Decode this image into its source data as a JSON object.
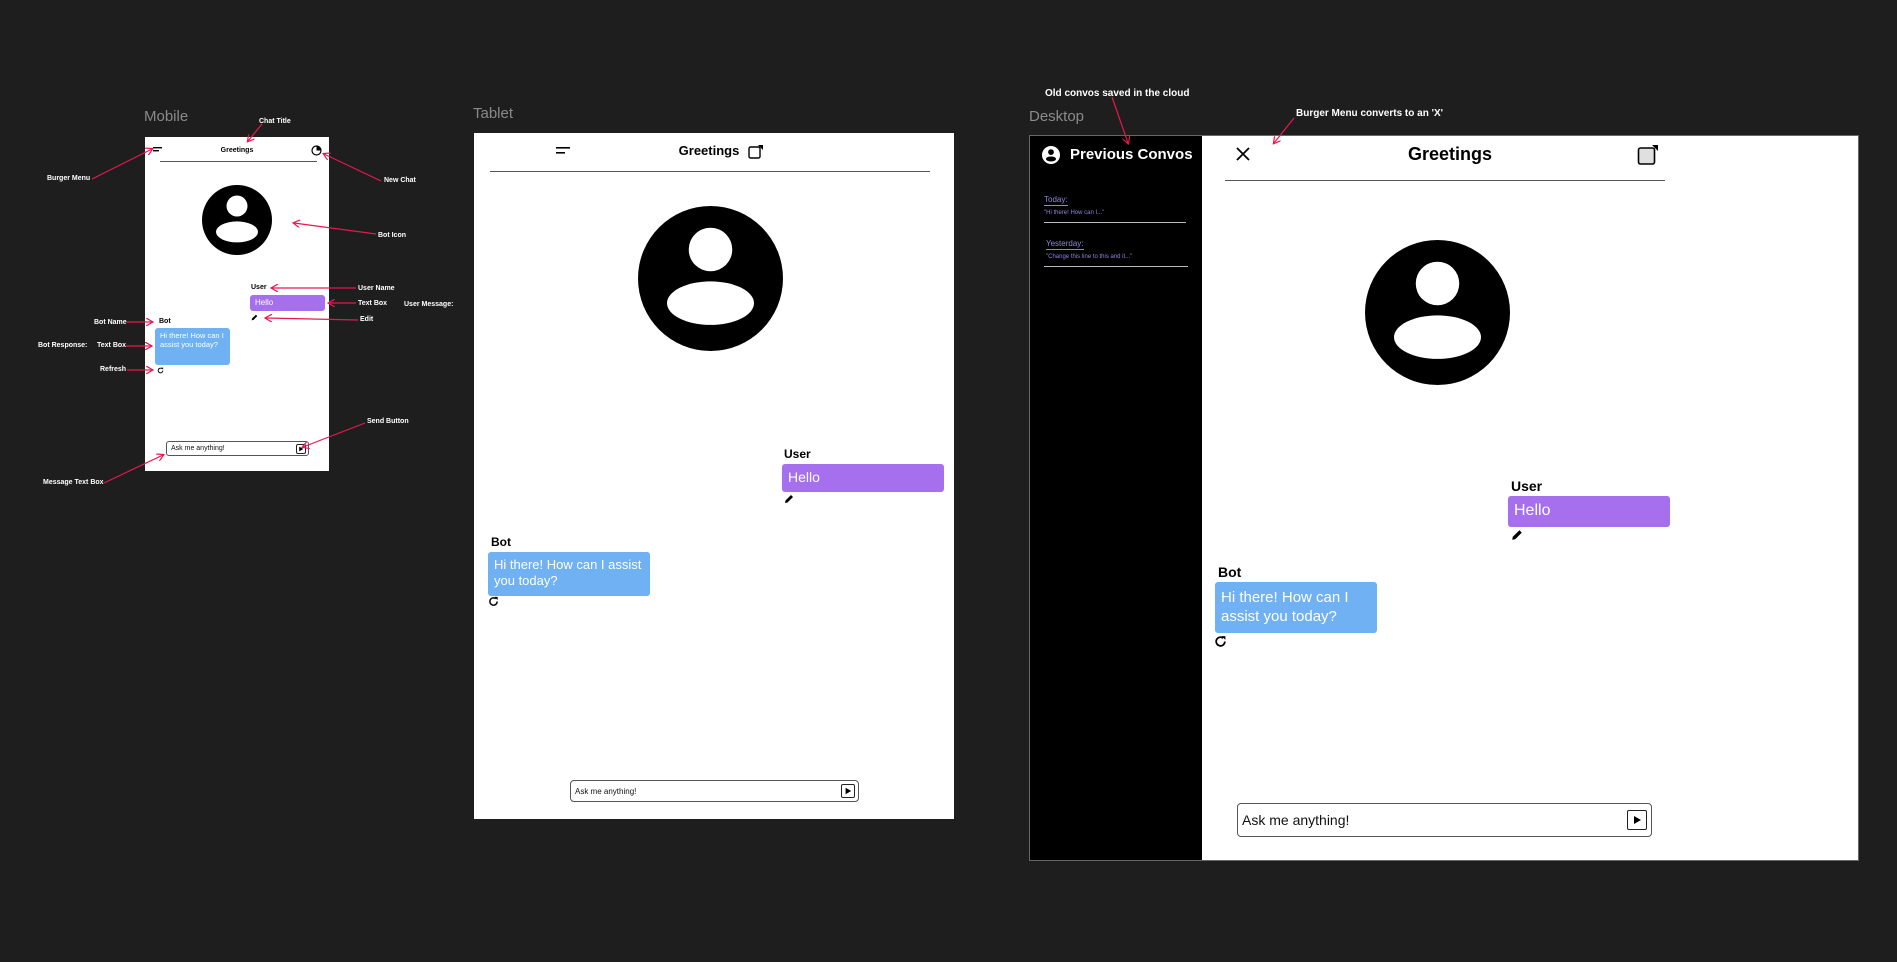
{
  "colors": {
    "canvas": "#1e1e1e",
    "screen": "#ffffff",
    "user_bubble": "#a66fee",
    "bot_bubble": "#6fb1f2",
    "annotation_arrow": "#e8174f",
    "sidebar": "#000000",
    "sidebar_text": "#8e86d8"
  },
  "frames": {
    "mobile_label": "Mobile",
    "tablet_label": "Tablet",
    "desktop_label": "Desktop"
  },
  "chat": {
    "title": "Greetings",
    "user_name": "User",
    "user_message": "Hello",
    "bot_name": "Bot",
    "bot_message": "Hi there! How can I assist you today?",
    "input_placeholder": "Ask me anything!"
  },
  "sidebar": {
    "heading": "Previous Convos",
    "convos": [
      {
        "day": "Today:",
        "preview": "\"Hi there! How can I...\""
      },
      {
        "day": "Yesterday:",
        "preview": "\"Change this line to this and it...\""
      }
    ]
  },
  "annotations": {
    "chat_title": "Chat Title",
    "burger_menu": "Burger Menu",
    "new_chat": "New Chat",
    "bot_icon": "Bot Icon",
    "user_name": "User Name",
    "text_box_user": "Text Box",
    "user_message": "User Message:",
    "edit": "Edit",
    "bot_name": "Bot Name",
    "bot_response": "Bot Response:",
    "text_box_bot": "Text Box",
    "refresh": "Refresh",
    "send_button": "Send Button",
    "message_text_box": "Message Text Box",
    "old_convos": "Old convos saved in the cloud",
    "burger_converts": "Burger Menu converts to an 'X'"
  },
  "icons": [
    "burger-menu-icon",
    "new-chat-icon",
    "bot-avatar-icon",
    "edit-pencil-icon",
    "refresh-icon",
    "send-play-icon",
    "close-x-icon",
    "account-circle-icon"
  ]
}
